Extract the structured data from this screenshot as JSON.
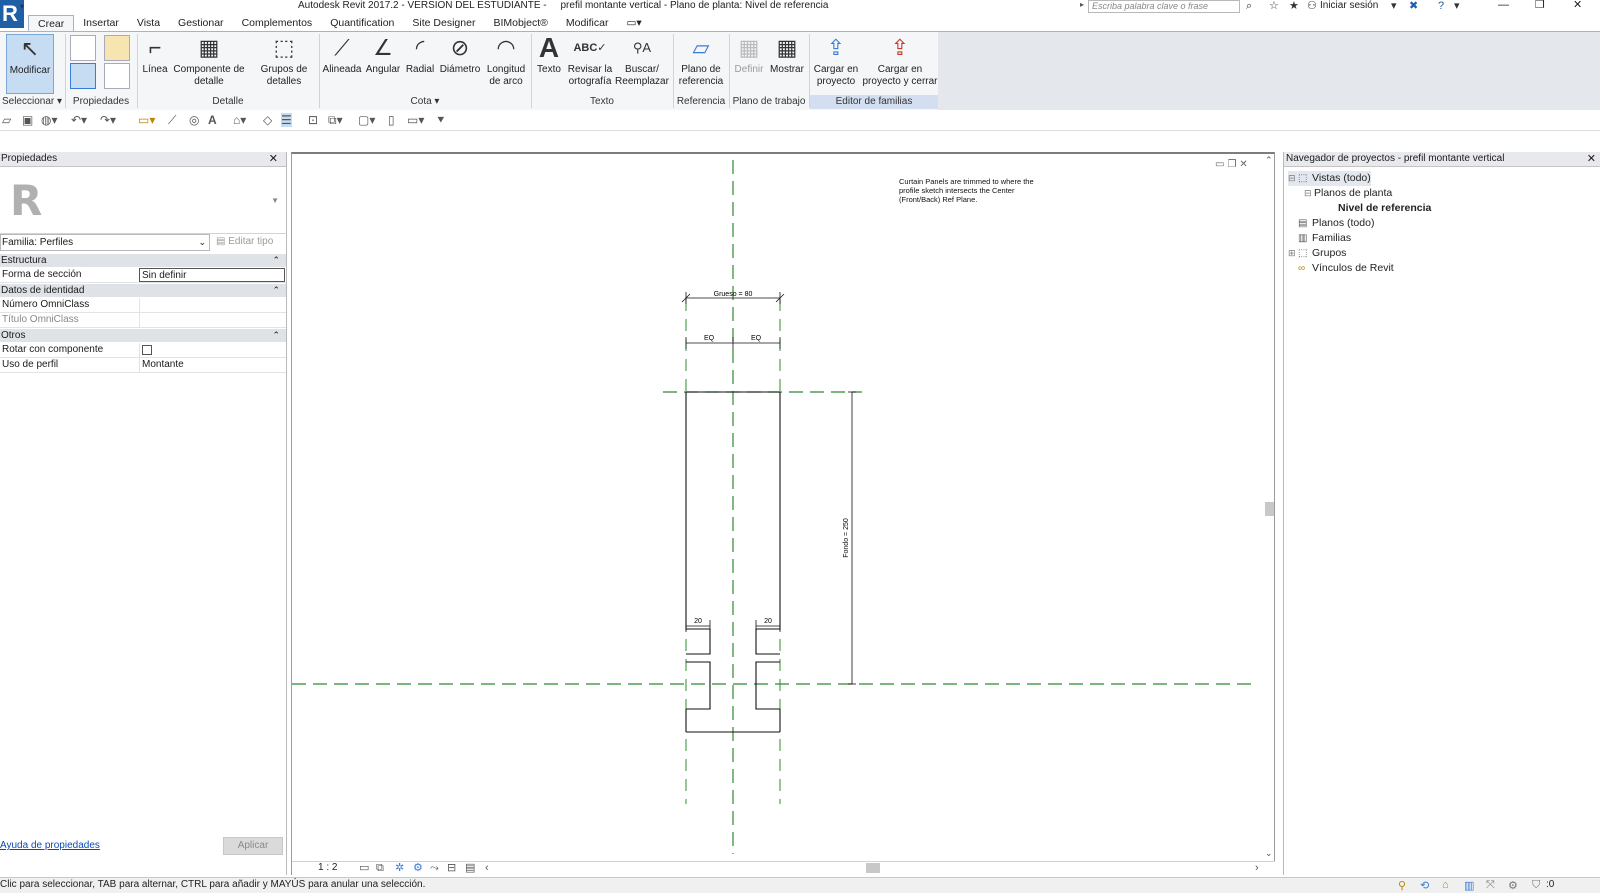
{
  "window": {
    "title": "Autodesk Revit 2017.2 - VERSION DEL ESTUDIANTE -     prefil montante vertical - Plano de planta: Nivel de referencia",
    "search_placeholder": "Escriba palabra clave o frase",
    "signin": "Iniciar sesión",
    "minimize": "—",
    "restore": "❐",
    "close": "✕"
  },
  "app_logo": "R",
  "tabs": [
    "Crear",
    "Insertar",
    "Vista",
    "Gestionar",
    "Complementos",
    "Quantification",
    "Site Designer",
    "BIMobject®",
    "Modificar"
  ],
  "ribbon": {
    "modificar": "Modificar",
    "linea": "Línea",
    "componente": "Componente de detalle",
    "grupos": "Grupos de detalles",
    "alineada": "Alineada",
    "angular": "Angular",
    "radial": "Radial",
    "diametro": "Diámetro",
    "longitud": "Longitud de arco",
    "texto": "Texto",
    "revisar": "Revisar la ortografía",
    "buscar": "Buscar/ Reemplazar",
    "plano": "Plano de referencia",
    "definir": "Definir",
    "mostrar": "Mostrar",
    "cargar": "Cargar en proyecto",
    "cargar_cerrar": "Cargar en proyecto y cerrar",
    "groups": {
      "seleccionar": "Seleccionar ▾",
      "propiedades": "Propiedades",
      "detalle": "Detalle",
      "cota": "Cota ▾",
      "texto": "Texto",
      "referencia": "Referencia",
      "plano_trabajo": "Plano de trabajo",
      "editor": "Editor de familias"
    }
  },
  "properties": {
    "title": "Propiedades",
    "family": "Familia: Perfiles",
    "edit_type": "Editar tipo",
    "sections": {
      "estructura": "Estructura",
      "identidad": "Datos de identidad",
      "otros": "Otros"
    },
    "rows": {
      "forma_k": "Forma de sección",
      "forma_v": "Sin definir",
      "omni_num": "Número OmniClass",
      "omni_tit": "Título OmniClass",
      "rotar": "Rotar con componente",
      "uso_k": "Uso de perfil",
      "uso_v": "Montante"
    },
    "help": "Ayuda de propiedades",
    "apply": "Aplicar"
  },
  "canvas": {
    "note": "Curtain Panels are trimmed to where the profile sketch intersects the Center (Front/Back) Ref Plane.",
    "dims": {
      "grueso": "Grueso = 80",
      "eq1": "EQ",
      "eq2": "EQ",
      "fondo": "Fondo = 250",
      "d20a": "20",
      "d20b": "20"
    },
    "scale": "1 : 2"
  },
  "browser": {
    "title": "Navegador de proyectos - prefil montante vertical",
    "items": {
      "vistas": "Vistas (todo)",
      "planos_planta": "Planos de planta",
      "nivel": "Nivel de referencia",
      "planos": "Planos (todo)",
      "familias": "Familias",
      "grupos": "Grupos",
      "vinculos": "Vínculos de Revit"
    }
  },
  "status": {
    "text": "Clic para seleccionar, TAB para alternar, CTRL para añadir y MAYÚS para anular una selección.",
    "filter_count": ":0"
  }
}
